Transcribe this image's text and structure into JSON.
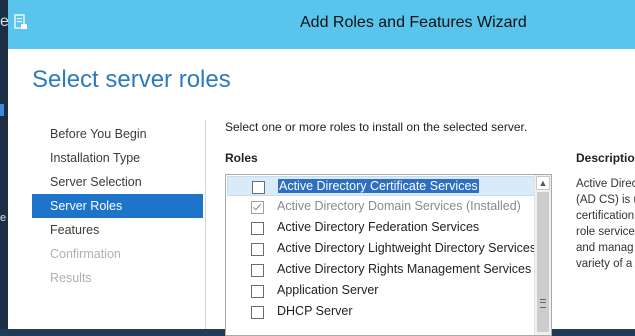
{
  "window": {
    "title": "Add Roles and Features Wizard",
    "heading": "Select server roles"
  },
  "nav": {
    "items": [
      {
        "label": "Before You Begin",
        "state": "normal"
      },
      {
        "label": "Installation Type",
        "state": "normal"
      },
      {
        "label": "Server Selection",
        "state": "normal"
      },
      {
        "label": "Server Roles",
        "state": "active"
      },
      {
        "label": "Features",
        "state": "normal"
      },
      {
        "label": "Confirmation",
        "state": "disabled"
      },
      {
        "label": "Results",
        "state": "disabled"
      }
    ]
  },
  "main": {
    "instruction": "Select one or more roles to install on the selected server.",
    "roles_label": "Roles",
    "roles": [
      {
        "label": "Active Directory Certificate Services",
        "checked": false,
        "selected": true,
        "installed": false
      },
      {
        "label": "Active Directory Domain Services (Installed)",
        "checked": true,
        "selected": false,
        "installed": true
      },
      {
        "label": "Active Directory Federation Services",
        "checked": false,
        "selected": false,
        "installed": false
      },
      {
        "label": "Active Directory Lightweight Directory Services",
        "checked": false,
        "selected": false,
        "installed": false
      },
      {
        "label": "Active Directory Rights Management Services",
        "checked": false,
        "selected": false,
        "installed": false
      },
      {
        "label": "Application Server",
        "checked": false,
        "selected": false,
        "installed": false
      },
      {
        "label": "DHCP Server",
        "checked": false,
        "selected": false,
        "installed": false
      }
    ]
  },
  "description": {
    "label": "Description",
    "lines": [
      "Active Direc",
      "(AD CS) is u",
      "certification",
      "role service",
      "and manag",
      "variety of a"
    ]
  },
  "colors": {
    "titlebar": "#59c4ec",
    "heading": "#2c7abf",
    "nav_active": "#1e74c8",
    "selection": "#2e6fc0"
  }
}
